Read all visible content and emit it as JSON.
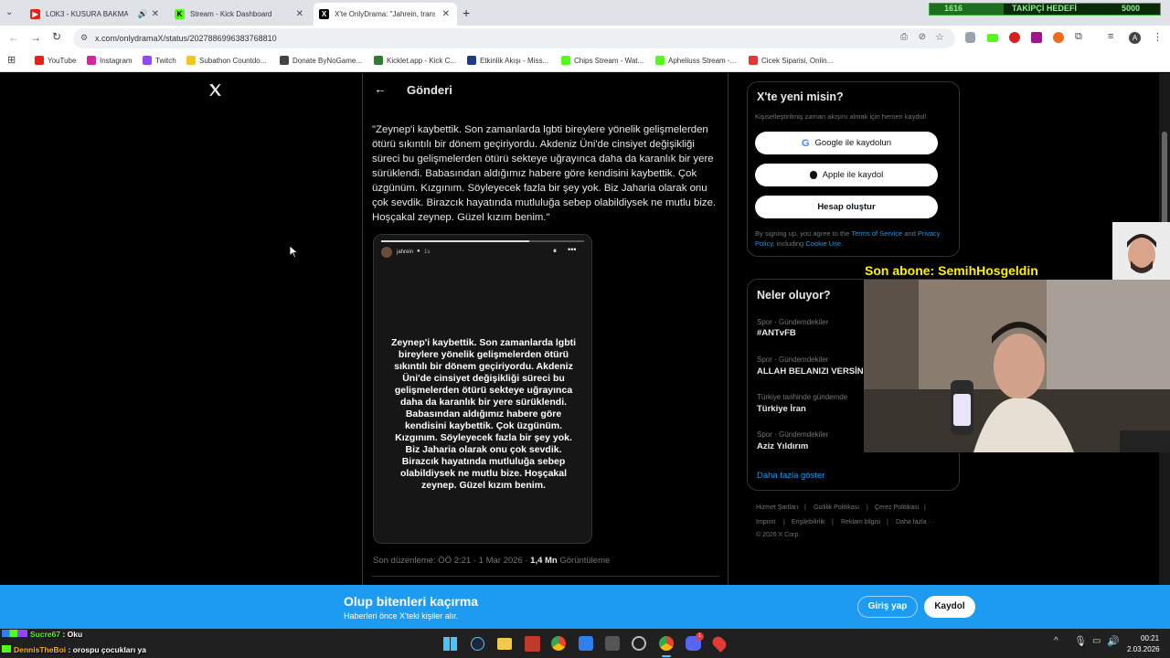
{
  "browser": {
    "tabs": [
      {
        "label": "LOK3 - KUSURA BAKMA (",
        "fav_color": "#e62117",
        "fav_text": "▶"
      },
      {
        "label": "Stream - Kick Dashboard",
        "fav_color": "#53fc18",
        "fav_text": "K"
      },
      {
        "label": "X'te OnlyDrama: \"Jahrein, trans",
        "fav_color": "#000000",
        "fav_text": "X"
      }
    ],
    "new_tab": "+",
    "url": "x.com/onlydramaX/status/2027886996383768810",
    "bookmarks": [
      {
        "label": "YouTube",
        "color": "#e62117"
      },
      {
        "label": "Instagram",
        "color": "#d6249f"
      },
      {
        "label": "Twitch",
        "color": "#9146ff"
      },
      {
        "label": "Subathon Countdo...",
        "color": "#f5c518"
      },
      {
        "label": "Donate ByNoGame...",
        "color": "#444444"
      },
      {
        "label": "Kicklet.app - Kick C...",
        "color": "#2e7d32"
      },
      {
        "label": "Etkinlik Akışı - Miss...",
        "color": "#1e3a8a"
      },
      {
        "label": "Chips Stream - Wat...",
        "color": "#53fc18"
      },
      {
        "label": "Apheliuss Stream -...",
        "color": "#53fc18"
      },
      {
        "label": "Cicek Siparisi, Onlin...",
        "color": "#e53935"
      }
    ]
  },
  "goal": {
    "current": "1616",
    "label": "TAKİPÇİ HEDEFİ",
    "target": "5000",
    "progress": 0.3232
  },
  "header": {
    "back": "←",
    "title": "Gönderi"
  },
  "tweet": {
    "text": "\"Zeynep'i kaybettik. Son zamanlarda lgbti bireylere yönelik gelişmelerden ötürü sıkıntılı bir dönem geçiriyordu. Akdeniz Üni'de cinsiyet değişikliği süreci bu gelişmelerden ötürü sekteye uğrayınca daha da karanlık bir yere sürüklendi. Babasından aldığımız habere göre kendisini kaybettik. Çok üzgünüm. Kızgınım. Söyleyecek fazla bir şey yok. Biz Jaharia olarak onu çok sevdik. Birazcık hayatında mutluluğa sebep olabildiysek ne mutlu bize. Hoşçakal zeynep. Güzel kızım benim.\"",
    "story_user": "jahrein",
    "story_time": "1s",
    "story_text": "Zeynep'i kaybettik. Son zamanlarda lgbti bireylere yönelik gelişmelerden ötürü sıkıntılı bir dönem geçiriyordu. Akdeniz Üni'de cinsiyet değişikliği süreci bu gelişmelerden ötürü sekteye uğrayınca daha da karanlık bir yere sürüklendi. Babasından aldığımız habere göre kendisini kaybettik. Çok üzgünüm. Kızgınım. Söyleyecek fazla bir şey yok. Biz Jaharia olarak onu çok sevdik. Birazcık hayatında mutluluğa sebep olabildiysek ne mutlu bize. Hoşçakal zeynep. Güzel kızım benim.",
    "meta_prefix": "Son düzenleme: ÖÖ 2:21 · 1 Mar 2026 · ",
    "views_count": "1,4 Mn",
    "views_label": "Görüntüleme"
  },
  "signup": {
    "title": "X'te yeni misin?",
    "subtitle": "Kişiselleştirilmiş zaman akışını almak için hemen kaydol!",
    "google": "Google ile kaydolun",
    "apple": "Apple ile kaydol",
    "create": "Hesap oluştur",
    "legal_1": "By signing up, you agree to the ",
    "tos": "Terms of Service",
    "legal_2": " and ",
    "privacy": "Privacy Policy",
    "legal_3": ", including ",
    "cookie": "Cookie Use",
    "legal_4": "."
  },
  "trends": {
    "title": "Neler oluyor?",
    "items": [
      {
        "category": "Spor · Gündemdekiler",
        "name": "#ANTvFB"
      },
      {
        "category": "Spor · Gündemdekiler",
        "name": "ALLAH BELANIZI VERSİN"
      },
      {
        "category": "Türkiye tarihinde gündemde",
        "name": "Türkiye İran"
      },
      {
        "category": "Spor · Gündemdekiler",
        "name": "Aziz Yıldırım"
      }
    ],
    "more": "Daha fazla göster"
  },
  "footer": {
    "links": [
      "Hizmet Şartları",
      "Gizlilik Politikası",
      "Çerez Politikası",
      "Imprint",
      "Erişilebilirlik",
      "Reklam bilgisi",
      "Daha fazla ···"
    ],
    "copyright": "© 2026 X Corp."
  },
  "overlay": {
    "subscriber": "Son abone: SemihHosgeldin"
  },
  "banner": {
    "title": "Olup bitenleri kaçırma",
    "subtitle": "Haberleri önce X'teki kişiler alır.",
    "login": "Giriş yap",
    "signup": "Kaydol"
  },
  "chat": [
    {
      "user": "Sucre67",
      "text": " : Oku",
      "color": "#53fc18"
    },
    {
      "user": "DennisTheBoi",
      "text": " : orospu çocukları ya",
      "color": "#ffb020"
    }
  ],
  "taskbar": {
    "time": "00:21",
    "date": "2.03.2026",
    "discord_badge": "1"
  }
}
